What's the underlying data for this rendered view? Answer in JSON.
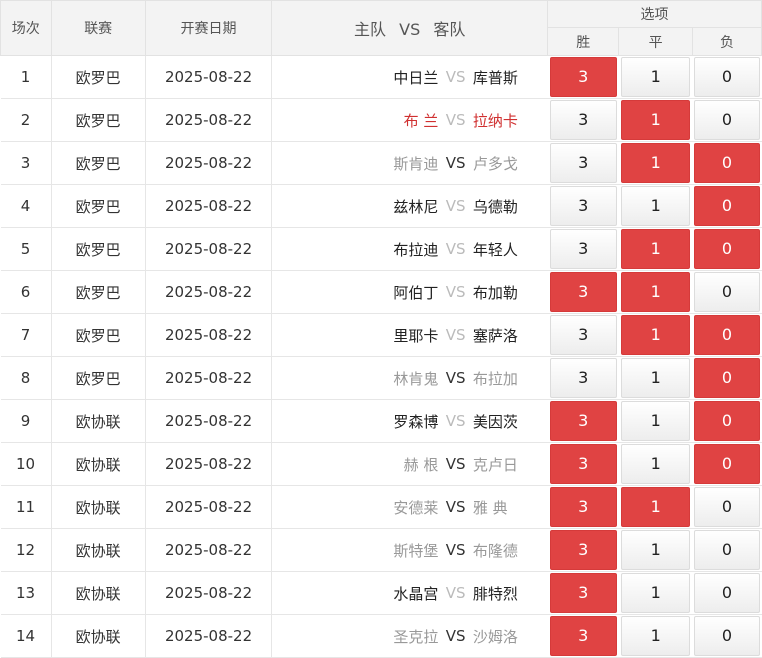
{
  "header": {
    "col_index": "场次",
    "col_league": "联赛",
    "col_date": "开赛日期",
    "col_home": "主队",
    "col_vs": "VS",
    "col_away": "客队",
    "col_options": "选项",
    "opt_win": "胜",
    "opt_draw": "平",
    "opt_lose": "负"
  },
  "rows": [
    {
      "idx": "1",
      "league": "欧罗巴",
      "date": "2025-08-22",
      "home": "中日兰",
      "vs": "VS",
      "away": "库普斯",
      "style": "black",
      "w": "3",
      "d": "1",
      "l": "0",
      "sel": [
        true,
        false,
        false
      ]
    },
    {
      "idx": "2",
      "league": "欧罗巴",
      "date": "2025-08-22",
      "home": "布 兰",
      "vs": "VS",
      "away": "拉纳卡",
      "style": "red",
      "w": "3",
      "d": "1",
      "l": "0",
      "sel": [
        false,
        true,
        false
      ]
    },
    {
      "idx": "3",
      "league": "欧罗巴",
      "date": "2025-08-22",
      "home": "斯肯迪",
      "vs": "VS",
      "away": "卢多戈",
      "style": "gray",
      "w": "3",
      "d": "1",
      "l": "0",
      "sel": [
        false,
        true,
        true
      ]
    },
    {
      "idx": "4",
      "league": "欧罗巴",
      "date": "2025-08-22",
      "home": "兹林尼",
      "vs": "VS",
      "away": "乌德勒",
      "style": "black",
      "w": "3",
      "d": "1",
      "l": "0",
      "sel": [
        false,
        false,
        true
      ]
    },
    {
      "idx": "5",
      "league": "欧罗巴",
      "date": "2025-08-22",
      "home": "布拉迪",
      "vs": "VS",
      "away": "年轻人",
      "style": "black",
      "w": "3",
      "d": "1",
      "l": "0",
      "sel": [
        false,
        true,
        true
      ]
    },
    {
      "idx": "6",
      "league": "欧罗巴",
      "date": "2025-08-22",
      "home": "阿伯丁",
      "vs": "VS",
      "away": "布加勒",
      "style": "black",
      "w": "3",
      "d": "1",
      "l": "0",
      "sel": [
        true,
        true,
        false
      ]
    },
    {
      "idx": "7",
      "league": "欧罗巴",
      "date": "2025-08-22",
      "home": "里耶卡",
      "vs": "VS",
      "away": "塞萨洛",
      "style": "black",
      "w": "3",
      "d": "1",
      "l": "0",
      "sel": [
        false,
        true,
        true
      ]
    },
    {
      "idx": "8",
      "league": "欧罗巴",
      "date": "2025-08-22",
      "home": "林肯鬼",
      "vs": "VS",
      "away": "布拉加",
      "style": "gray",
      "w": "3",
      "d": "1",
      "l": "0",
      "sel": [
        false,
        false,
        true
      ]
    },
    {
      "idx": "9",
      "league": "欧协联",
      "date": "2025-08-22",
      "home": "罗森博",
      "vs": "VS",
      "away": "美因茨",
      "style": "black",
      "w": "3",
      "d": "1",
      "l": "0",
      "sel": [
        true,
        false,
        true
      ]
    },
    {
      "idx": "10",
      "league": "欧协联",
      "date": "2025-08-22",
      "home": "赫 根",
      "vs": "VS",
      "away": "克卢日",
      "style": "gray",
      "w": "3",
      "d": "1",
      "l": "0",
      "sel": [
        true,
        false,
        true
      ]
    },
    {
      "idx": "11",
      "league": "欧协联",
      "date": "2025-08-22",
      "home": "安德莱",
      "vs": "VS",
      "away": "雅 典",
      "style": "gray",
      "w": "3",
      "d": "1",
      "l": "0",
      "sel": [
        true,
        true,
        false
      ]
    },
    {
      "idx": "12",
      "league": "欧协联",
      "date": "2025-08-22",
      "home": "斯特堡",
      "vs": "VS",
      "away": "布隆德",
      "style": "gray",
      "w": "3",
      "d": "1",
      "l": "0",
      "sel": [
        true,
        false,
        false
      ]
    },
    {
      "idx": "13",
      "league": "欧协联",
      "date": "2025-08-22",
      "home": "水晶宫",
      "vs": "VS",
      "away": "腓特烈",
      "style": "black",
      "w": "3",
      "d": "1",
      "l": "0",
      "sel": [
        true,
        false,
        false
      ]
    },
    {
      "idx": "14",
      "league": "欧协联",
      "date": "2025-08-22",
      "home": "圣克拉",
      "vs": "VS",
      "away": "沙姆洛",
      "style": "gray",
      "w": "3",
      "d": "1",
      "l": "0",
      "sel": [
        true,
        false,
        false
      ]
    }
  ],
  "colors": {
    "selected": "#e04343",
    "red_text": "#d03030",
    "gray_text": "#999999"
  }
}
